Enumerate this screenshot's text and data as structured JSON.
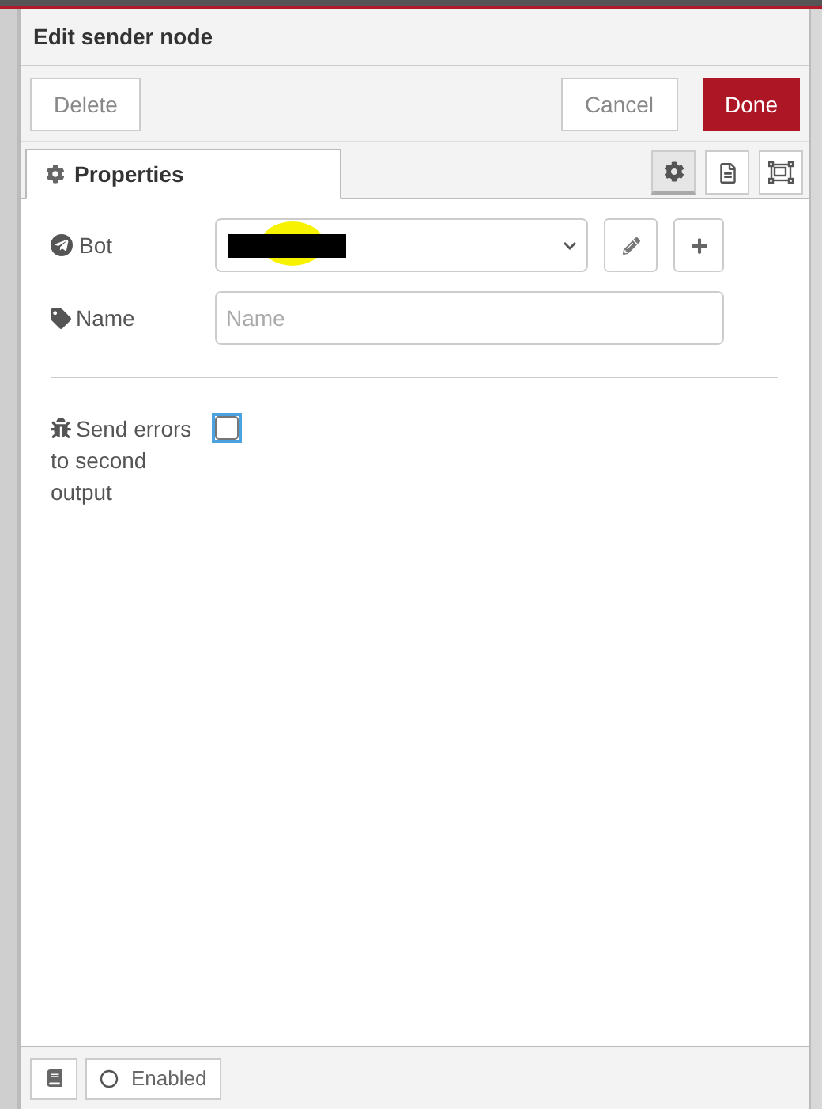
{
  "dialog": {
    "title": "Edit sender node"
  },
  "buttons": {
    "delete": "Delete",
    "cancel": "Cancel",
    "done": "Done"
  },
  "tabs": [
    {
      "label": "Properties",
      "selected": true
    }
  ],
  "icon_tabs": [
    {
      "kind": "gear",
      "selected": true
    },
    {
      "kind": "document",
      "selected": false
    },
    {
      "kind": "frame",
      "selected": false
    }
  ],
  "form": {
    "bot": {
      "label": "Bot",
      "redacted": true
    },
    "name": {
      "label": "Name",
      "placeholder": "Name"
    },
    "send_errors": {
      "label": "Send errors to second output",
      "checked": false
    }
  },
  "footer": {
    "enabled_label": "Enabled"
  }
}
